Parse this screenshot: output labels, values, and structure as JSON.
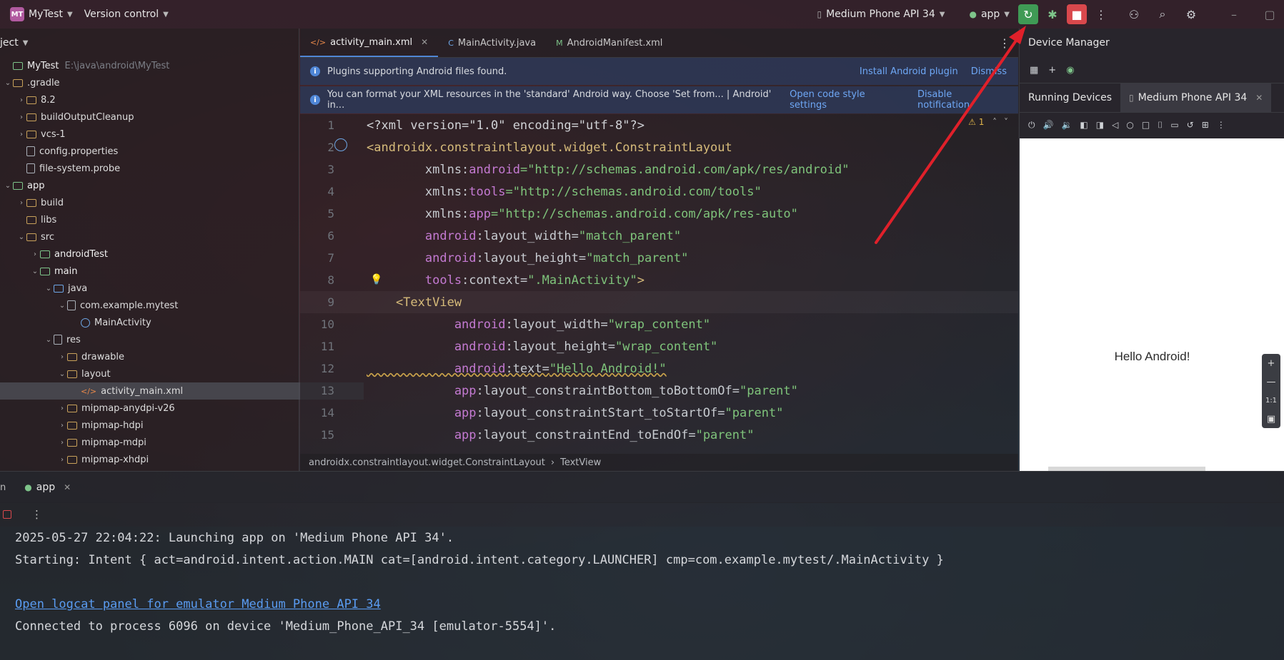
{
  "titlebar": {
    "logo": "MT",
    "project_name": "MyTest",
    "vcs": "Version control",
    "device_selector": "Medium Phone API 34",
    "run_config": "app"
  },
  "project": {
    "header": "ject",
    "tree": [
      {
        "label": "MyTest",
        "hint": "E:\\java\\android\\MyTest",
        "indent": 0,
        "kind": "module",
        "arrow": ""
      },
      {
        "label": ".gradle",
        "indent": 0,
        "kind": "folder",
        "arrow": "v"
      },
      {
        "label": "8.2",
        "indent": 1,
        "kind": "folder",
        "arrow": ">"
      },
      {
        "label": "buildOutputCleanup",
        "indent": 1,
        "kind": "folder",
        "arrow": ">"
      },
      {
        "label": "vcs-1",
        "indent": 1,
        "kind": "folder",
        "arrow": ">"
      },
      {
        "label": "config.properties",
        "indent": 1,
        "kind": "file",
        "arrow": ""
      },
      {
        "label": "file-system.probe",
        "indent": 1,
        "kind": "file",
        "arrow": ""
      },
      {
        "label": "app",
        "indent": 0,
        "kind": "module",
        "arrow": "v"
      },
      {
        "label": "build",
        "indent": 1,
        "kind": "folder",
        "arrow": ">"
      },
      {
        "label": "libs",
        "indent": 1,
        "kind": "folder",
        "arrow": ""
      },
      {
        "label": "src",
        "indent": 1,
        "kind": "folder",
        "arrow": "v"
      },
      {
        "label": "androidTest",
        "indent": 2,
        "kind": "module",
        "arrow": ">"
      },
      {
        "label": "main",
        "indent": 2,
        "kind": "module",
        "arrow": "v"
      },
      {
        "label": "java",
        "indent": 3,
        "kind": "blue",
        "arrow": "v"
      },
      {
        "label": "com.example.mytest",
        "indent": 4,
        "kind": "file",
        "arrow": "v"
      },
      {
        "label": "MainActivity",
        "indent": 5,
        "kind": "class",
        "arrow": ""
      },
      {
        "label": "res",
        "indent": 3,
        "kind": "file",
        "arrow": "v"
      },
      {
        "label": "drawable",
        "indent": 4,
        "kind": "folder",
        "arrow": ">"
      },
      {
        "label": "layout",
        "indent": 4,
        "kind": "folder",
        "arrow": "v"
      },
      {
        "label": "activity_main.xml",
        "indent": 5,
        "kind": "xml",
        "arrow": "",
        "selected": true
      },
      {
        "label": "mipmap-anydpi-v26",
        "indent": 4,
        "kind": "folder",
        "arrow": ">"
      },
      {
        "label": "mipmap-hdpi",
        "indent": 4,
        "kind": "folder",
        "arrow": ">"
      },
      {
        "label": "mipmap-mdpi",
        "indent": 4,
        "kind": "folder",
        "arrow": ">"
      },
      {
        "label": "mipmap-xhdpi",
        "indent": 4,
        "kind": "folder",
        "arrow": ">"
      }
    ]
  },
  "editor": {
    "tabs": [
      {
        "label": "activity_main.xml",
        "icon": "</>",
        "active": true,
        "closable": true
      },
      {
        "label": "MainActivity.java",
        "icon": "C",
        "active": false,
        "closable": false
      },
      {
        "label": "AndroidManifest.xml",
        "icon": "M",
        "active": false,
        "closable": false
      }
    ],
    "banner1": {
      "text": "Plugins supporting Android files found.",
      "link1": "Install Android plugin",
      "link2": "Dismiss"
    },
    "banner2": {
      "text": "You can format your XML resources in the 'standard' Android way. Choose 'Set from... | Android' in...",
      "link1": "Open code style settings",
      "link2": "Disable notification"
    },
    "warning_count": "1",
    "lines": [
      [
        {
          "t": "<?xml version=\"1.0\" encoding=\"utf-8\"?>",
          "c": "plain"
        }
      ],
      [
        {
          "t": "<androidx.constraintlayout.widget.ConstraintLayout",
          "c": "tag"
        }
      ],
      [
        {
          "t": "        xmlns:",
          "c": "attr"
        },
        {
          "t": "android",
          "c": "ns"
        },
        {
          "t": "=\"http://schemas.android.com/apk/res/android\"",
          "c": "str"
        }
      ],
      [
        {
          "t": "        xmlns:",
          "c": "attr"
        },
        {
          "t": "tools",
          "c": "ns"
        },
        {
          "t": "=\"http://schemas.android.com/tools\"",
          "c": "str"
        }
      ],
      [
        {
          "t": "        xmlns:",
          "c": "attr"
        },
        {
          "t": "app",
          "c": "ns"
        },
        {
          "t": "=\"http://schemas.android.com/apk/res-auto\"",
          "c": "str"
        }
      ],
      [
        {
          "t": "        android",
          "c": "ns"
        },
        {
          "t": ":layout_width=",
          "c": "attr"
        },
        {
          "t": "\"match_parent\"",
          "c": "str"
        }
      ],
      [
        {
          "t": "        android",
          "c": "ns"
        },
        {
          "t": ":layout_height=",
          "c": "attr"
        },
        {
          "t": "\"match_parent\"",
          "c": "str"
        }
      ],
      [
        {
          "t": "        tools",
          "c": "ns"
        },
        {
          "t": ":context=",
          "c": "attr"
        },
        {
          "t": "\".MainActivity\"",
          "c": "str"
        },
        {
          "t": ">",
          "c": "tag"
        }
      ],
      [
        {
          "t": "    <TextView",
          "c": "tag"
        }
      ],
      [
        {
          "t": "            android",
          "c": "ns"
        },
        {
          "t": ":layout_width=",
          "c": "attr"
        },
        {
          "t": "\"wrap_content\"",
          "c": "str"
        }
      ],
      [
        {
          "t": "            android",
          "c": "ns"
        },
        {
          "t": ":layout_height=",
          "c": "attr"
        },
        {
          "t": "\"wrap_content\"",
          "c": "str"
        }
      ],
      [
        {
          "t": "            android",
          "c": "ns"
        },
        {
          "t": ":text=",
          "c": "attr"
        },
        {
          "t": "\"Hello Android!\"",
          "c": "str"
        }
      ],
      [
        {
          "t": "            app",
          "c": "ns"
        },
        {
          "t": ":layout_constraintBottom_toBottomOf=",
          "c": "attr"
        },
        {
          "t": "\"parent\"",
          "c": "str"
        }
      ],
      [
        {
          "t": "            app",
          "c": "ns"
        },
        {
          "t": ":layout_constraintStart_toStartOf=",
          "c": "attr"
        },
        {
          "t": "\"parent\"",
          "c": "str"
        }
      ],
      [
        {
          "t": "            app",
          "c": "ns"
        },
        {
          "t": ":layout_constraintEnd_toEndOf=",
          "c": "attr"
        },
        {
          "t": "\"parent\"",
          "c": "str"
        }
      ]
    ],
    "breadcrumb": [
      "androidx.constraintlayout.widget.ConstraintLayout",
      "TextView"
    ]
  },
  "device_manager": {
    "title": "Device Manager",
    "tabs": [
      "Running Devices",
      "Medium Phone API 34"
    ],
    "screen_text": "Hello Android!",
    "zoom": [
      "+",
      "—",
      "1:1",
      "▣"
    ]
  },
  "run": {
    "tab": "app",
    "console": [
      {
        "text": "2025-05-27 22:04:22: Launching app on 'Medium Phone API 34'.",
        "link": false
      },
      {
        "text": "Starting: Intent { act=android.intent.action.MAIN cat=[android.intent.category.LAUNCHER] cmp=com.example.mytest/.MainActivity }",
        "link": false
      },
      {
        "text": "",
        "link": false
      },
      {
        "text": "Open logcat panel for emulator Medium Phone API 34",
        "link": true
      },
      {
        "text": "Connected to process 6096 on device 'Medium_Phone_API_34 [emulator-5554]'.",
        "link": false
      }
    ]
  },
  "colors": {
    "accent": "#4f86d6",
    "run_green": "#3f9a55",
    "stop_red": "#d9484c",
    "arrow": "#e0202a"
  }
}
